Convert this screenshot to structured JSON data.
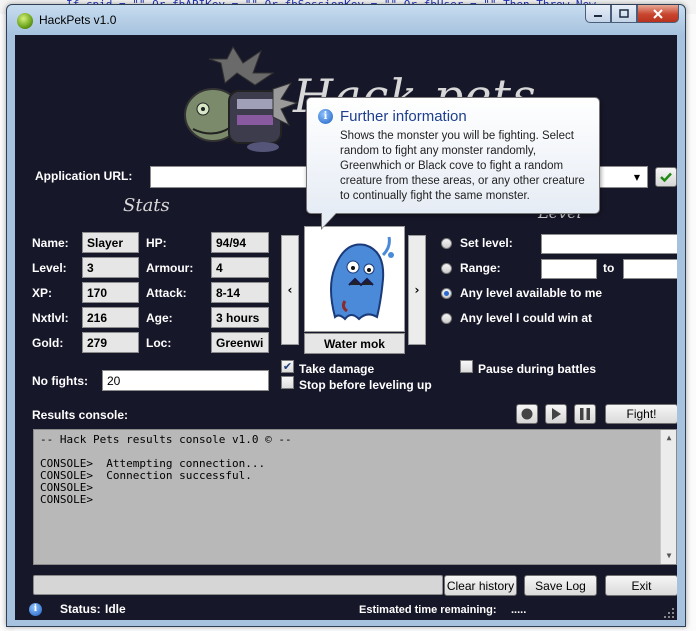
{
  "background": {
    "code_line": "If cpid = \"\" Or fbAPIKey = \"\" Or fbSessionKey = \"\" Or fbUser = \"\" Then Throw New"
  },
  "window": {
    "title": "HackPets v1.0",
    "logo_text": "Hack pets"
  },
  "app_url": {
    "label": "Application URL:",
    "value": ""
  },
  "stats": {
    "title": "Stats",
    "rows": [
      {
        "label": "Name:",
        "value": "Slayer"
      },
      {
        "label": "Level:",
        "value": "3"
      },
      {
        "label": "XP:",
        "value": "170"
      },
      {
        "label": "Nxtlvl:",
        "value": "216"
      },
      {
        "label": "Gold:",
        "value": "279"
      }
    ],
    "rows2": [
      {
        "label": "HP:",
        "value": "94/94"
      },
      {
        "label": "Armour:",
        "value": "4"
      },
      {
        "label": "Attack:",
        "value": "8-14"
      },
      {
        "label": "Age:",
        "value": "3 hours"
      },
      {
        "label": "Loc:",
        "value": "Greenwi"
      }
    ]
  },
  "monster": {
    "name": "Water mok",
    "prev": "‹",
    "next": "›"
  },
  "level": {
    "title": "Level",
    "options": [
      {
        "label": "Set level:",
        "selected": false
      },
      {
        "label": "Range:",
        "selected": false
      },
      {
        "label": "Any level available to me",
        "selected": true
      },
      {
        "label": "Any level I could win at",
        "selected": false
      }
    ],
    "set_level_value": "",
    "range_from": "",
    "range_to_label": "to",
    "range_to": ""
  },
  "fights": {
    "label": "No fights:",
    "value": "20"
  },
  "options": {
    "take_damage": {
      "label": "Take damage",
      "checked": true
    },
    "stop_before_level": {
      "label": "Stop before leveling up",
      "checked": false
    },
    "pause_battles": {
      "label": "Pause during battles",
      "checked": false
    }
  },
  "results": {
    "label": "Results console:",
    "fight_button": "Fight!",
    "console_lines": "-- Hack Pets results console v1.0 © --\n\nCONSOLE>  Attempting connection...\nCONSOLE>  Connection successful.\nCONSOLE>\nCONSOLE>"
  },
  "footer": {
    "clear_history": "Clear history",
    "save_log": "Save Log",
    "exit": "Exit",
    "status_label": "Status:",
    "status_value": "Idle",
    "time_label": "Estimated time remaining:",
    "time_value": "....."
  },
  "tooltip": {
    "title": "Further information",
    "body": "Shows the monster you will be fighting. Select random to fight any monster randomly, Greenwhich or Black cove to fight a random creature from these areas, or any other creature to continually fight the same monster."
  },
  "colors": {
    "client_bg": "#17172a",
    "accent_blue": "#1e3f8e",
    "go_green": "#1f8a12"
  }
}
